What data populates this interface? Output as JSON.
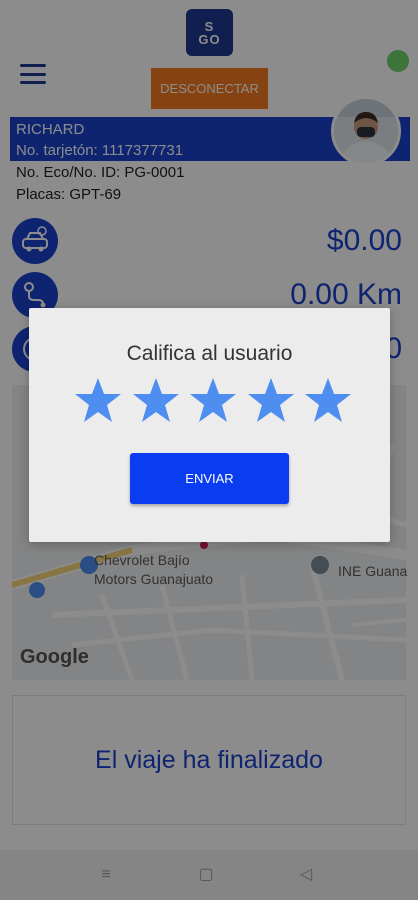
{
  "header": {
    "logo_top": "S",
    "logo_bottom": "GO",
    "disconnect_label": "DESCONECTAR"
  },
  "driver": {
    "name": "RICHARD",
    "card_no": "No. tarjetón: 1117377731",
    "eco_id": "No. Eco/No. ID: PG-0001",
    "plates": "Placas: GPT-69"
  },
  "metrics": {
    "fare": "$0.00",
    "distance": "0.00 Km",
    "time": "0"
  },
  "map": {
    "poi_1_line1": "Chevrolet Bajío",
    "poi_1_line2": "Motors Guanajuato",
    "poi_2": "INE Guana",
    "attribution": "Google"
  },
  "trip": {
    "status": "El viaje ha finalizado"
  },
  "dialog": {
    "title": "Califica al usuario",
    "rating": 5,
    "rating_max": 5,
    "send_label": "ENVIAR"
  },
  "colors": {
    "brand_blue": "#1d43cc",
    "orange": "#f47a20",
    "star_blue": "#4d8ef0",
    "online": "#6fd36a"
  }
}
